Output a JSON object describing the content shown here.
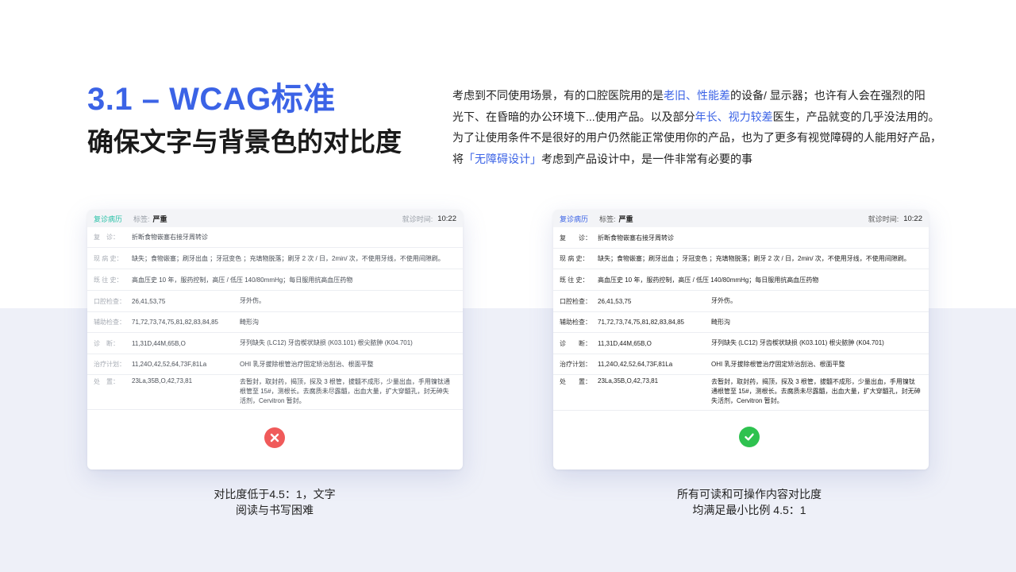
{
  "heading": "3.1 – WCAG标准",
  "subheading": "确保文字与背景色的对比度",
  "intro": {
    "line1_a": "考虑到不同使用场景，有的口腔医院用的是",
    "line1_hl": "老旧、性能差",
    "line1_b": "的设备/ 显示器；也许有人会在强烈的阳",
    "line2_a": "光下、在昏暗的办公环境下...使用产品。以及部分",
    "line2_hl": "年长、视力较差",
    "line2_b": "医生，产品就变的几乎没法用的。",
    "line3": "为了让使用条件不是很好的用户仍然能正常使用你的产品，也为了更多有视觉障碍的人能用好产品，",
    "line4_a": "将",
    "line4_hl": "「无障碍设计」",
    "line4_b": "考虑到产品设计中，是一件非常有必要的事"
  },
  "colors": {
    "accent": "#3b63e6",
    "bad_accent": "#2cc2a8",
    "error": "#f05a5a",
    "success": "#2ec24f",
    "band": "#eef0f8"
  },
  "record": {
    "title": "复诊病历",
    "tag_key": "标签:",
    "tag_value": "严重",
    "time_key": "就诊时间:",
    "time_value": "10:22",
    "rows": [
      {
        "label": "复　诊：",
        "v1": "折断食物嵌塞右接牙周转诊",
        "v2": ""
      },
      {
        "label": "现 病 史：",
        "v1": "缺失；食物嵌塞；刷牙出血 ；牙冠变色 ；充填物脱落；刷牙 2 次 / 日，2min/ 次，不使用牙线，不使用间隙刷。",
        "v2": ""
      },
      {
        "label": "既 往 史：",
        "v1": "高血压史  10 年，服药控制，高压 / 低压  140/80mmHg；每日服用抗高血压药物",
        "v2": ""
      },
      {
        "label": "口腔检查：",
        "v1": "26,41,53,75",
        "v2": "牙外伤。"
      },
      {
        "label": "辅助检查：",
        "v1": "71,72,73,74,75,81,82,83,84,85",
        "v2": "畸形沟"
      },
      {
        "label": "诊　断：",
        "v1": "11,31D,44M,65B,O",
        "v2": "牙列缺失 (LC12) 牙齿楔状缺损 (K03.101) 根尖脓肿 (K04.701)"
      },
      {
        "label": "治疗计划：",
        "v1": "11,24O,42,52,64,73F,81La",
        "v2": "OHI 乳牙拔除根管治疗固定矫治刮治、根面平整"
      },
      {
        "label": "处　置：",
        "v1": "23La,35B,O,42,73,81",
        "v2": "去暂封，取封药，揭顶，探及 3 根管，拔髓不成形，少量出血，手用镍钛通根管至 15#，测根长。去腐质未尽露髓，出血大量，扩大穿髓孔，封无砷失活剂，Cervitron 暂封。"
      }
    ]
  },
  "good_record": {
    "rows": [
      {
        "label": "复　　诊："
      },
      {
        "label": "现 病 史："
      },
      {
        "label": "既 往 史："
      },
      {
        "label": "口腔检查："
      },
      {
        "label": "辅助检查："
      },
      {
        "label": "诊　　断："
      },
      {
        "label": "治疗计划："
      },
      {
        "label": "处　　置："
      }
    ]
  },
  "captions": {
    "bad_line1": "对比度低于4.5：1，文字",
    "bad_line2": "阅读与书写困难",
    "good_line1": "所有可读和可操作内容对比度",
    "good_line2": "均满足最小比例 4.5：1"
  },
  "icons": {
    "bad": "error-circle-icon",
    "good": "check-circle-icon"
  }
}
